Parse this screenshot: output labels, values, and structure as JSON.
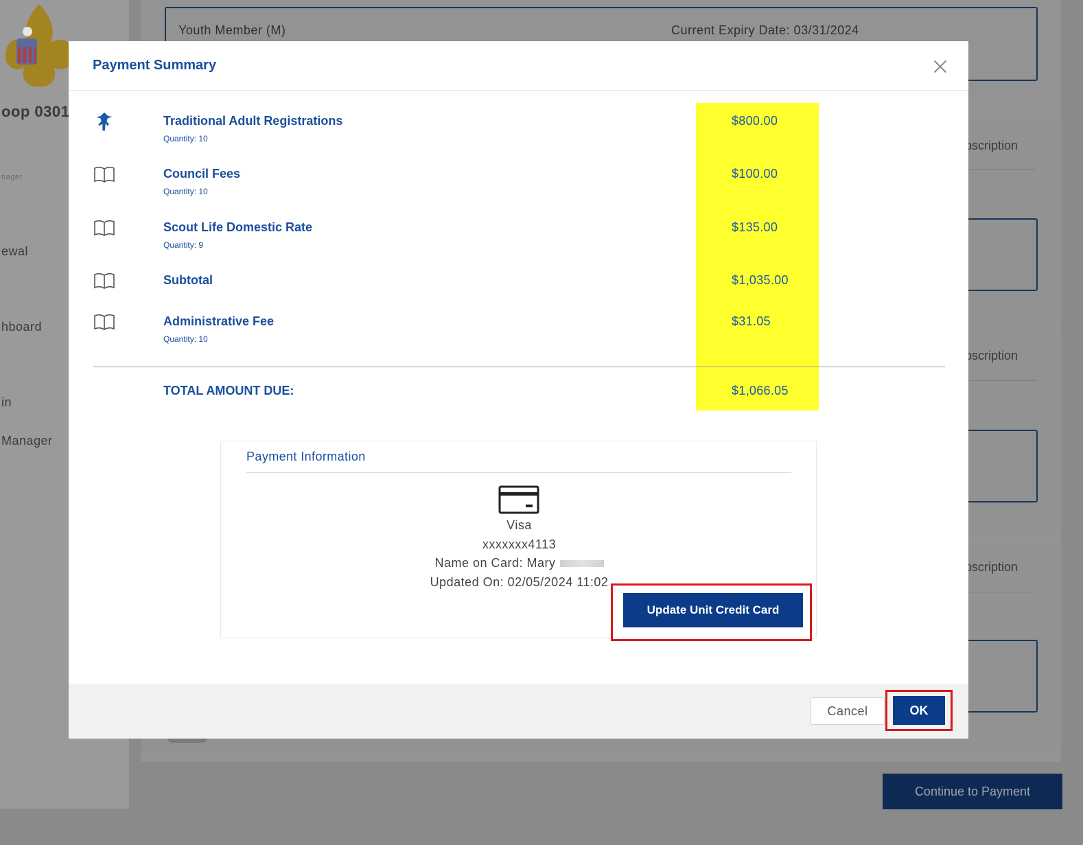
{
  "background": {
    "member": {
      "type": "Youth Member (M)",
      "expiry": "Current Expiry Date: 03/31/2024"
    },
    "sidebar": {
      "unit": "oop 0301",
      "small_label": "nager",
      "items": [
        "ewal",
        "hboard",
        "in",
        "Manager"
      ]
    },
    "desc_labels": [
      "bscription",
      "bscription",
      "bscription"
    ],
    "continue_label": "Continue to Payment"
  },
  "modal": {
    "title": "Payment Summary",
    "items": [
      {
        "name": "Traditional Adult Registrations",
        "quantity": "Quantity: 10",
        "amount": "$800.00",
        "icon": "scout-icon"
      },
      {
        "name": "Council Fees",
        "quantity": "Quantity: 10",
        "amount": "$100.00",
        "icon": "book-icon"
      },
      {
        "name": "Scout Life Domestic Rate",
        "quantity": "Quantity: 9",
        "amount": "$135.00",
        "icon": "book-icon"
      },
      {
        "name": "Subtotal",
        "quantity": "",
        "amount": "$1,035.00",
        "icon": "book-icon"
      },
      {
        "name": "Administrative Fee",
        "quantity": "Quantity: 10",
        "amount": "$31.05",
        "icon": "book-icon"
      }
    ],
    "total": {
      "label": "TOTAL AMOUNT DUE:",
      "amount": "$1,066.05"
    },
    "payment": {
      "title": "Payment Information",
      "card_brand": "Visa",
      "card_number": "xxxxxxx4113",
      "name_on_card": "Name on Card: Mary",
      "updated_on": "Updated On: 02/05/2024 11:02",
      "update_button": "Update Unit Credit Card"
    },
    "footer": {
      "cancel": "Cancel",
      "ok": "OK"
    }
  },
  "colors": {
    "brand_blue": "#0b3b89",
    "link_blue": "#1b4f9c",
    "highlight": "#ffff2e",
    "annotation_red": "#d9181b"
  }
}
